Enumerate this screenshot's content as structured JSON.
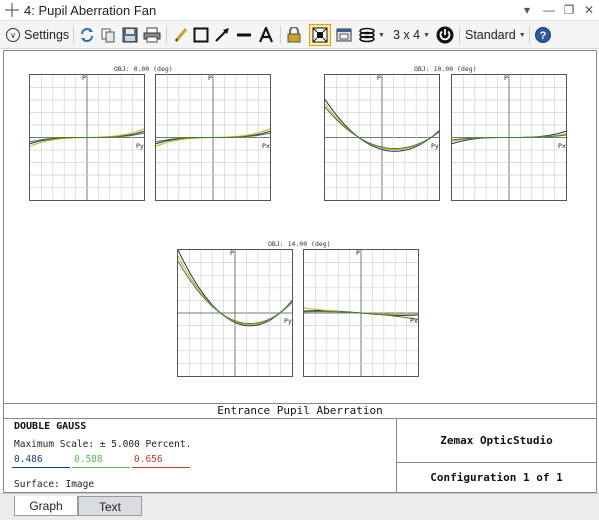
{
  "window": {
    "title": "4: Pupil Aberration Fan"
  },
  "toolbar": {
    "settings_label": "Settings",
    "layout_label": "3 x 4",
    "standard_label": "Standard"
  },
  "graph": {
    "field_labels": [
      "OBJ: 0.00 (deg)",
      "OBJ: 10.00 (deg)",
      "OBJ: 14.00 (deg)"
    ],
    "axis_p": "P",
    "axis_py": "Py",
    "axis_px": "Px",
    "caption": "Entrance Pupil Aberration"
  },
  "info": {
    "lens_title": "DOUBLE GAUSS",
    "max_scale": "Maximum Scale: ± 5.000 Percent.",
    "wavelengths": [
      {
        "value": "0.486",
        "color": "#1a3a8a"
      },
      {
        "value": "0.588",
        "color": "#5cb85c"
      },
      {
        "value": "0.656",
        "color": "#c0392b"
      }
    ],
    "surface": "Surface: Image",
    "brand": "Zemax OpticStudio",
    "configuration": "Configuration 1 of 1"
  },
  "tabs": [
    {
      "label": "Graph",
      "active": true
    },
    {
      "label": "Text",
      "active": false
    }
  ],
  "colors": {
    "curve_blue": "#1f2f6e",
    "curve_yellow": "#c9b300",
    "curve_green": "#3a7d3a"
  }
}
